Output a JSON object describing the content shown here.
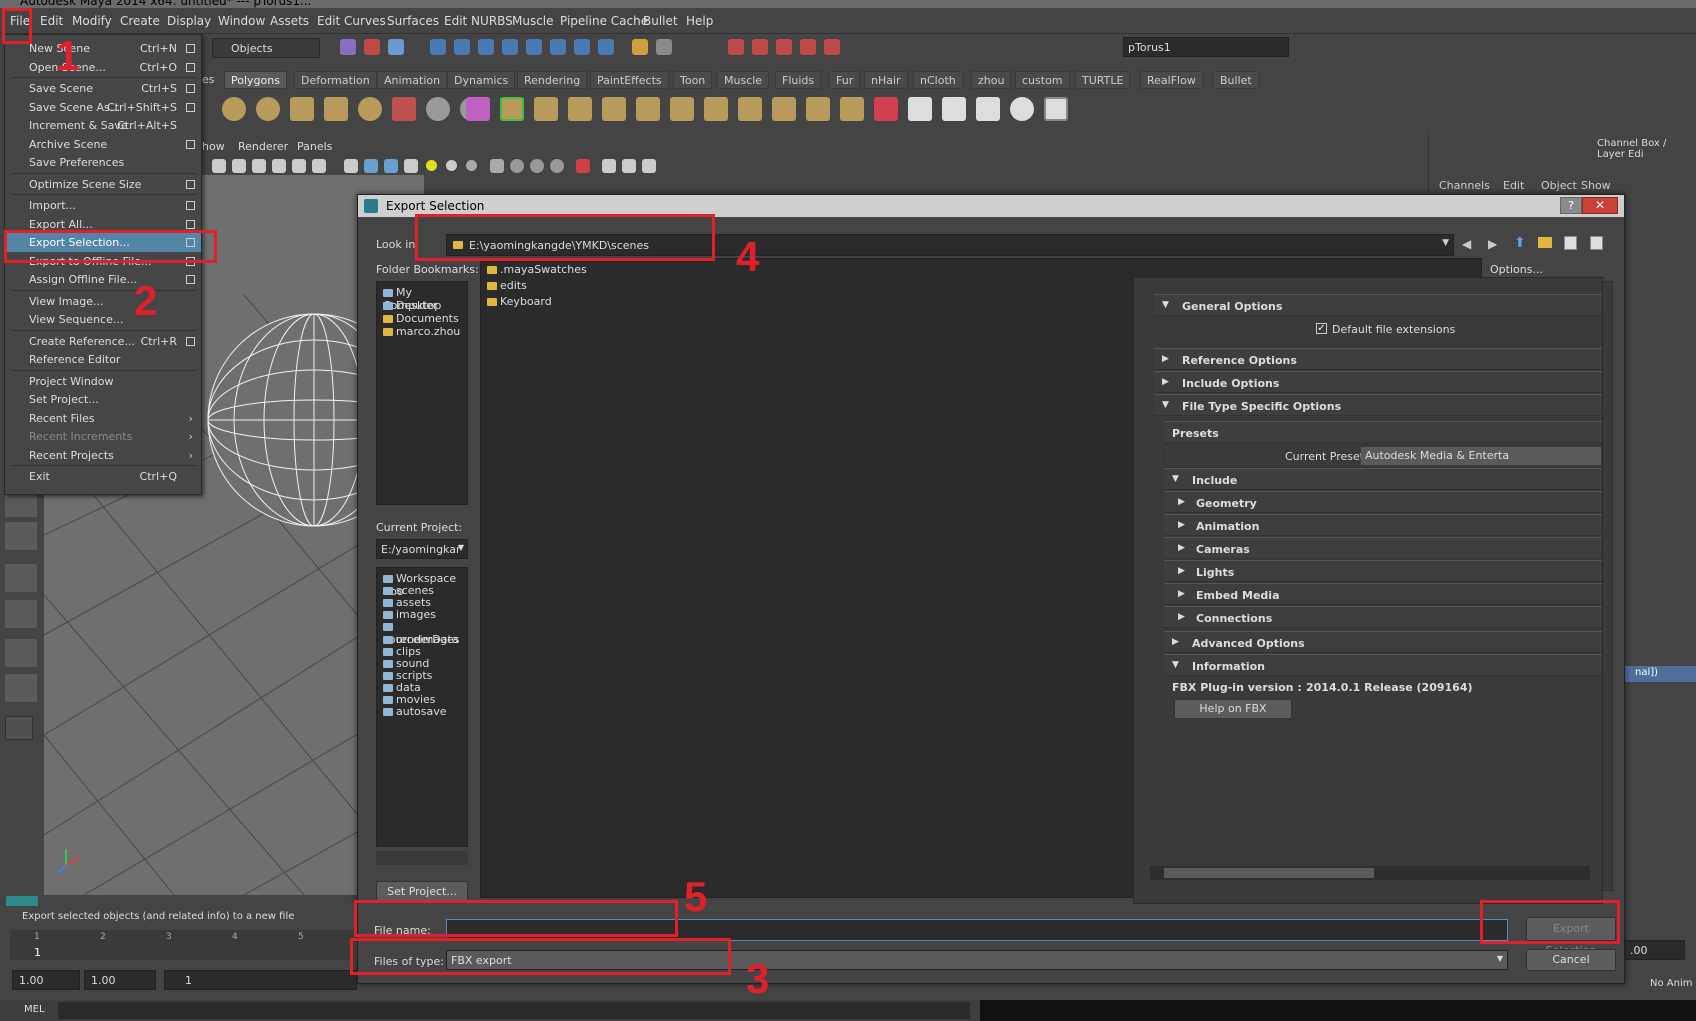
{
  "window_title": "Autodesk Maya 2014 x64: untitled* --- pTorus1...",
  "menubar": [
    "File",
    "Edit",
    "Modify",
    "Create",
    "Display",
    "Window",
    "Assets",
    "Edit Curves",
    "Surfaces",
    "Edit NURBS",
    "Muscle",
    "Pipeline Cache",
    "Bullet",
    "Help"
  ],
  "toolbar": {
    "mode_select": "Objects",
    "object_name": "pTorus1"
  },
  "shelf_tabs": [
    "Polygons",
    "Deformation",
    "Animation",
    "Dynamics",
    "Rendering",
    "PaintEffects",
    "Toon",
    "Muscle",
    "Fluids",
    "Fur",
    "nHair",
    "nCloth",
    "zhou",
    "custom",
    "TURTLE",
    "RealFlow",
    "Bullet"
  ],
  "shelf_tab_partial": "es",
  "panel_menu": [
    "how",
    "Renderer",
    "Panels"
  ],
  "right_panel": {
    "title": "Channel Box / Layer Edi",
    "menus": [
      "Channels",
      "Edit",
      "Object",
      "Show"
    ],
    "partial_text": "nal])"
  },
  "file_menu": [
    {
      "label": "New Scene",
      "shortcut": "Ctrl+N",
      "box": true
    },
    {
      "label": "Open Scene...",
      "shortcut": "Ctrl+O",
      "box": true
    },
    {
      "sep": true
    },
    {
      "label": "Save Scene",
      "shortcut": "Ctrl+S",
      "box": true
    },
    {
      "label": "Save Scene As...",
      "shortcut": "Ctrl+Shift+S",
      "box": true
    },
    {
      "label": "Increment & Save",
      "shortcut": "Ctrl+Alt+S",
      "box": false
    },
    {
      "label": "Archive Scene",
      "shortcut": "",
      "box": true
    },
    {
      "label": "Save Preferences",
      "shortcut": "",
      "box": false
    },
    {
      "sep": true
    },
    {
      "label": "Optimize Scene Size",
      "shortcut": "",
      "box": true
    },
    {
      "sep": true
    },
    {
      "label": "Import...",
      "shortcut": "",
      "box": true
    },
    {
      "label": "Export All...",
      "shortcut": "",
      "box": true
    },
    {
      "label": "Export Selection...",
      "shortcut": "",
      "box": true,
      "highlight": true
    },
    {
      "label": "Export to Offline File...",
      "shortcut": "",
      "box": true
    },
    {
      "label": "Assign Offline File...",
      "shortcut": "",
      "box": true
    },
    {
      "sep": true
    },
    {
      "label": "View Image...",
      "shortcut": "",
      "box": false
    },
    {
      "label": "View Sequence...",
      "shortcut": "",
      "box": false
    },
    {
      "sep": true
    },
    {
      "label": "Create Reference...",
      "shortcut": "Ctrl+R",
      "box": true
    },
    {
      "label": "Reference Editor",
      "shortcut": "",
      "box": false
    },
    {
      "sep": true
    },
    {
      "label": "Project Window",
      "shortcut": "",
      "box": false
    },
    {
      "label": "Set Project...",
      "shortcut": "",
      "box": false
    },
    {
      "label": "Recent Files",
      "shortcut": "",
      "arrow": true
    },
    {
      "label": "Recent Increments",
      "shortcut": "",
      "arrow": true,
      "disabled": true
    },
    {
      "label": "Recent Projects",
      "shortcut": "",
      "arrow": true
    },
    {
      "sep": true
    },
    {
      "label": "Exit",
      "shortcut": "Ctrl+Q",
      "box": false
    }
  ],
  "dialog": {
    "title": "Export Selection",
    "help_label": "?",
    "close_label": "✕",
    "look_in_label": "Look in:",
    "look_in_path": "E:\\yaomingkangde\\YMKD\\scenes",
    "bookmarks_label": "Folder Bookmarks:",
    "bookmarks": [
      "My Computer",
      "Desktop",
      "Documents",
      "marco.zhou"
    ],
    "files": [
      ".mayaSwatches",
      "edits",
      "Keyboard"
    ],
    "current_project_label": "Current Project:",
    "current_project": "E:/yaomingkar",
    "project_folders": [
      "Workspace Roo",
      "scenes",
      "assets",
      "images",
      "sourceimages",
      "renderData",
      "clips",
      "sound",
      "scripts",
      "data",
      "movies",
      "autosave"
    ],
    "set_project_label": "Set Project...",
    "options_label": "Options...",
    "general_options": "General Options",
    "default_ext_label": "Default file extensions",
    "reference_options": "Reference Options",
    "include_options": "Include Options",
    "file_type_specific": "File Type Specific Options",
    "presets_label": "Presets",
    "current_preset_label": "Current Preset:",
    "current_preset_value": "Autodesk Media & Enterta",
    "include_label": "Include",
    "include_items": [
      "Geometry",
      "Animation",
      "Cameras",
      "Lights",
      "Embed Media",
      "Connections"
    ],
    "advanced_options": "Advanced Options",
    "information_label": "Information",
    "fbx_version_label": "FBX Plug-in version :",
    "fbx_version_value": "2014.0.1 Release (209164)",
    "help_fbx_label": "Help on FBX",
    "file_name_label": "File name:",
    "file_name_value": "",
    "files_of_type_label": "Files of type:",
    "files_of_type_value": "FBX export",
    "export_button": "Export Selection",
    "cancel_button": "Cancel"
  },
  "status_line": "Export selected objects (and related info) to a new file",
  "timeline": {
    "ticks": [
      "1",
      "2",
      "3",
      "4",
      "5"
    ],
    "current_frame": "1",
    "start": "1.00",
    "start2": "1.00",
    "range_start": "1",
    "right_value": ".00",
    "anim_label": "No Anim"
  },
  "mel_label": "MEL",
  "annotations": {
    "colors": {
      "red": "#e0202a"
    },
    "numbers": [
      "1",
      "2",
      "3",
      "4",
      "5"
    ]
  }
}
